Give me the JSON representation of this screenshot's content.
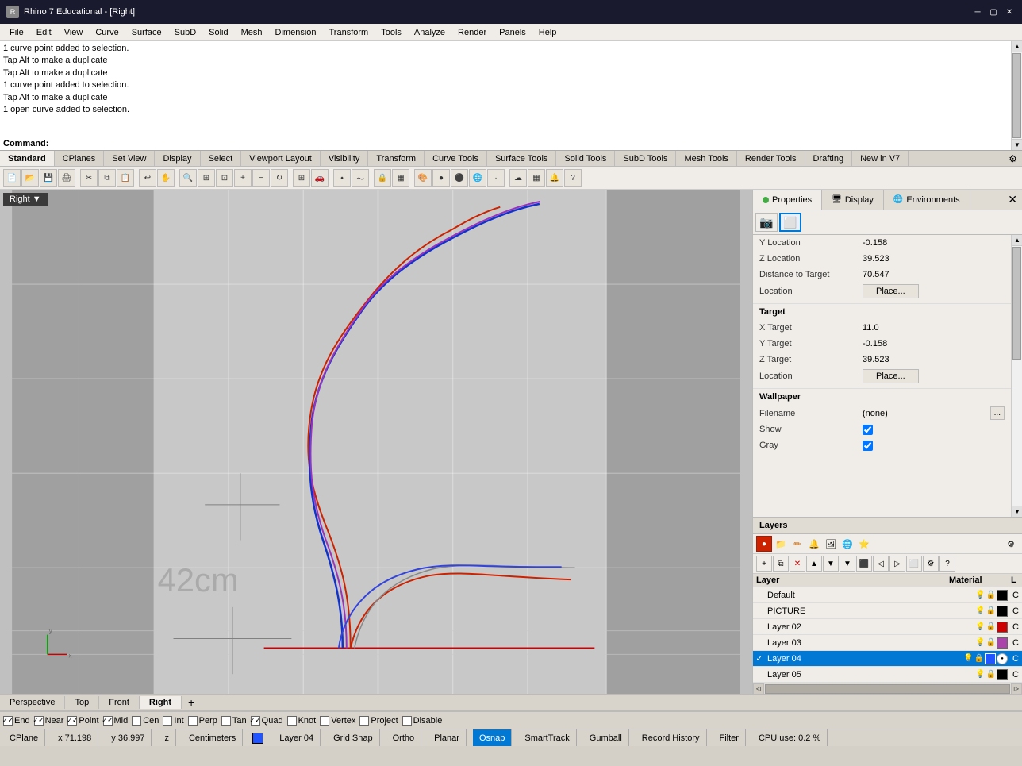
{
  "titlebar": {
    "title": "Rhino 7 Educational - [Right]",
    "icon": "rhino-icon",
    "controls": [
      "minimize",
      "maximize",
      "close"
    ]
  },
  "menubar": {
    "items": [
      "File",
      "Edit",
      "View",
      "Curve",
      "Surface",
      "SubD",
      "Solid",
      "Mesh",
      "Dimension",
      "Transform",
      "Tools",
      "Analyze",
      "Render",
      "Panels",
      "Help"
    ]
  },
  "command_output": {
    "lines": [
      "1 curve point added to selection.",
      "Tap Alt to make a duplicate",
      "Tap Alt to make a duplicate",
      "1 curve point added to selection.",
      "Tap Alt to make a duplicate",
      "1 open curve added to selection."
    ],
    "prompt": "Command:"
  },
  "toolbar": {
    "tabs": [
      "Standard",
      "CPlanes",
      "Set View",
      "Display",
      "Select",
      "Viewport Layout",
      "Visibility",
      "Transform",
      "Curve Tools",
      "Surface Tools",
      "Solid Tools",
      "SubD Tools",
      "Mesh Tools",
      "Render Tools",
      "Drafting",
      "New in V7"
    ]
  },
  "viewport": {
    "label": "Right",
    "dimension_label": "42cm",
    "grid_visible": true
  },
  "panel": {
    "tabs": [
      "Properties",
      "Display",
      "Environments"
    ],
    "properties": {
      "items": [
        {
          "label": "Y Location",
          "value": "-0.158"
        },
        {
          "label": "Z Location",
          "value": "39.523"
        },
        {
          "label": "Distance to Target",
          "value": "70.547"
        },
        {
          "label": "Location",
          "value": "",
          "button": "Place..."
        },
        {
          "section": "Target"
        },
        {
          "label": "X Target",
          "value": "11.0"
        },
        {
          "label": "Y Target",
          "value": "-0.158"
        },
        {
          "label": "Z Target",
          "value": "39.523"
        },
        {
          "label": "Location",
          "value": "",
          "button": "Place..."
        },
        {
          "section": "Wallpaper"
        },
        {
          "label": "Filename",
          "value": "(none)",
          "button": "..."
        },
        {
          "label": "Show",
          "value": "checked"
        },
        {
          "label": "Gray",
          "value": "checked"
        }
      ]
    }
  },
  "layers": {
    "title": "Layers",
    "columns": [
      "Layer",
      "Material",
      "L"
    ],
    "items": [
      {
        "name": "Default",
        "color": "#000000",
        "selected": false
      },
      {
        "name": "PICTURE",
        "color": "#000000",
        "selected": false
      },
      {
        "name": "Layer 02",
        "color": "#ff0000",
        "selected": false
      },
      {
        "name": "Layer 03",
        "color": "#aa44aa",
        "selected": false
      },
      {
        "name": "Layer 04",
        "color": "#2255ff",
        "selected": true,
        "checked": true
      },
      {
        "name": "Layer 05",
        "color": "#000000",
        "selected": false
      }
    ]
  },
  "viewport_tabs": {
    "items": [
      "Perspective",
      "Top",
      "Front",
      "Right"
    ],
    "active": "Right",
    "add_icon": "+"
  },
  "osnap": {
    "items": [
      {
        "label": "End",
        "checked": true
      },
      {
        "label": "Near",
        "checked": true
      },
      {
        "label": "Point",
        "checked": true
      },
      {
        "label": "Mid",
        "checked": true
      },
      {
        "label": "Cen",
        "checked": false
      },
      {
        "label": "Int",
        "checked": false
      },
      {
        "label": "Perp",
        "checked": false
      },
      {
        "label": "Tan",
        "checked": false
      },
      {
        "label": "Quad",
        "checked": true
      },
      {
        "label": "Knot",
        "checked": false
      },
      {
        "label": "Vertex",
        "checked": false
      },
      {
        "label": "Project",
        "checked": false
      },
      {
        "label": "Disable",
        "checked": false
      }
    ]
  },
  "statusbar": {
    "cplane": "CPlane",
    "x": "x 71.198",
    "y": "y 36.997",
    "z": "z",
    "units": "Centimeters",
    "layer": "Layer 04",
    "grid_snap": "Grid Snap",
    "ortho": "Ortho",
    "planar": "Planar",
    "osnap": "Osnap",
    "smart_track": "SmartTrack",
    "gumball": "Gumball",
    "record_history": "Record History",
    "filter": "Filter",
    "cpu": "CPU use: 0.2 %"
  }
}
